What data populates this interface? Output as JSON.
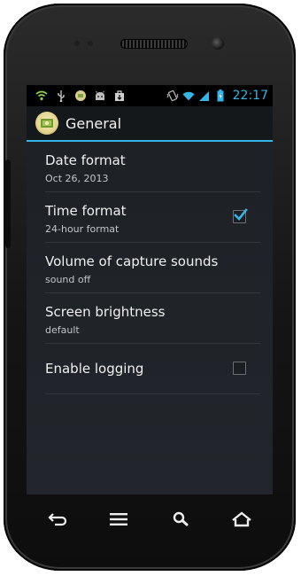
{
  "status_bar": {
    "time": "22:17",
    "accent_color": "#33b5e5",
    "left_icons": [
      "wifi-notification-icon",
      "usb-icon",
      "app-notification-icon",
      "android-debug-icon",
      "download-icon"
    ],
    "right_icons": [
      "vibrate-icon",
      "wifi-signal-icon",
      "cell-signal-icon",
      "battery-icon"
    ]
  },
  "action_bar": {
    "title": "General",
    "icon": "app-logo-icon"
  },
  "preferences": [
    {
      "title": "Date format",
      "summary": "Oct 26, 2013",
      "checkbox": null
    },
    {
      "title": "Time format",
      "summary": "24-hour format",
      "checkbox": true
    },
    {
      "title": "Volume of capture sounds",
      "summary": "sound off",
      "checkbox": null
    },
    {
      "title": "Screen brightness",
      "summary": "default",
      "checkbox": null
    },
    {
      "title": "Enable logging",
      "summary": "",
      "checkbox": false
    }
  ],
  "nav_buttons": [
    "back-icon",
    "menu-icon",
    "search-icon",
    "home-icon"
  ]
}
